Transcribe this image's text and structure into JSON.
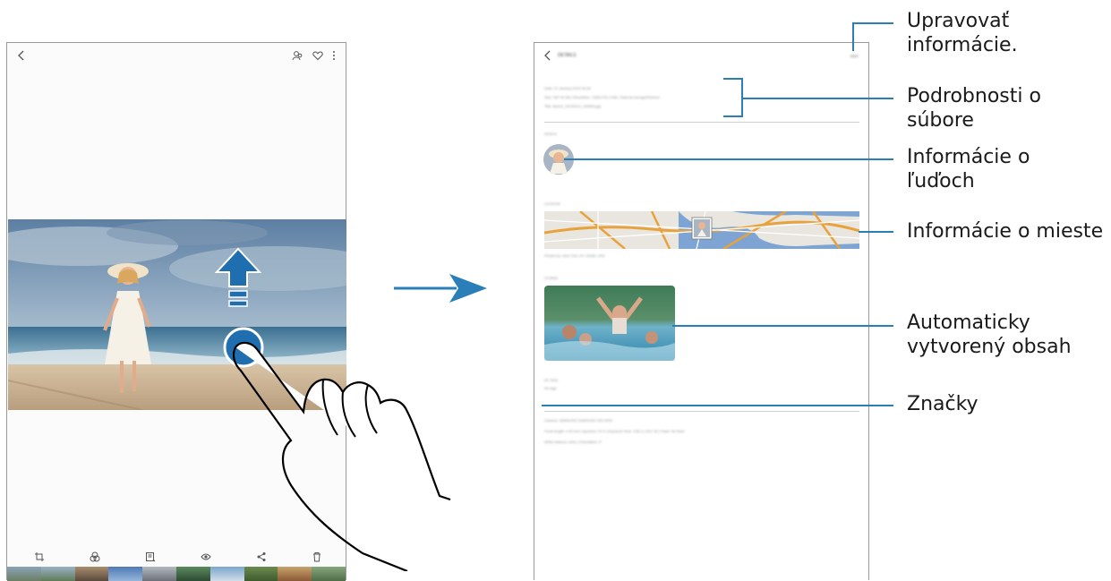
{
  "left_screen": {
    "toolbar_icons": [
      "back-icon",
      "people-icon",
      "heart-icon",
      "more-icon"
    ],
    "bottom_actions": [
      "edit-icon",
      "filters-icon",
      "details-icon",
      "share-icon",
      "delete-icon"
    ]
  },
  "right_screen": {
    "header": {
      "title": "DETAILS",
      "edit_label": "EDIT"
    },
    "file_info": [
      "Date: 21 January 2019 09:28",
      "Size: 987.00 KB   |   Resolution: 1280x720   |   Path: /Internal storage/Pictures",
      "Title: Beach_20190121_092800.jpg"
    ],
    "sections": {
      "people": "PEOPLE",
      "location": "LOCATION",
      "location_caption": "Printed by: New York, NY 10036, USA",
      "stories": "STORIES",
      "tags": "MY TAGS",
      "tags_value": "No tags"
    },
    "camera_info": [
      "Camera: SAMSUNG SAMSUNG SM-X00X",
      "Focal length: 4.00 mm   |   Aperture: f/2.4   |   Exposure time: 1/60 s   |   ISO: 50   |   Flash: No flash",
      "White balance: Auto   |   Orientation: 0°"
    ]
  },
  "callouts": {
    "edit": "Upravovať informácie.",
    "file": "Podrobnosti o súbore",
    "people": "Informácie o ľuďoch",
    "location": "Informácie o mieste",
    "auto_content": "Automaticky vytvorený obsah",
    "tags": "Značky"
  },
  "colors": {
    "accent": "#2b7fb8",
    "road": "#e8a23d",
    "water": "#7ea4d4"
  }
}
